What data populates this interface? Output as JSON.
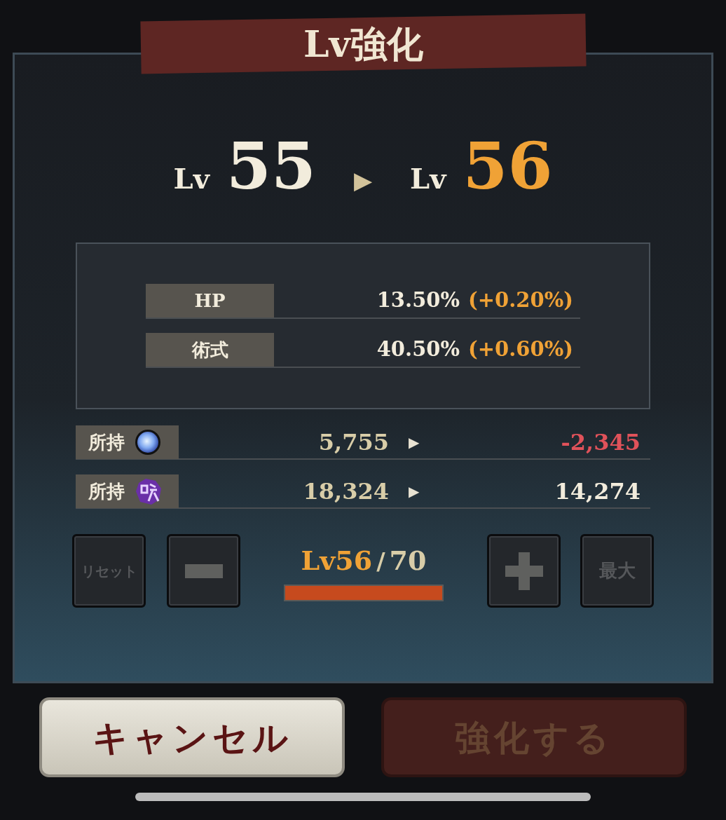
{
  "title": "Lv強化",
  "level_change": {
    "from_prefix": "Lv",
    "from": "55",
    "arrow": "▶",
    "to_prefix": "Lv",
    "to": "56"
  },
  "stats": [
    {
      "label": "HP",
      "value": "13.50%",
      "delta": "(+0.20%)"
    },
    {
      "label": "術式",
      "value": "40.50%",
      "delta": "(+0.60%)"
    }
  ],
  "resources": [
    {
      "label": "所持",
      "kind": "orb",
      "current": "5,755",
      "arrow": "▶",
      "after": "-2,345",
      "insufficient": true
    },
    {
      "label": "所持",
      "kind": "curse",
      "current": "18,324",
      "arrow": "▶",
      "after": "14,274",
      "insufficient": false
    }
  ],
  "controls": {
    "reset": {
      "label": "リセット",
      "disabled": true
    },
    "minus": {
      "disabled": true
    },
    "level_label": "Lv56",
    "separator": "/",
    "max_level": "70",
    "level": 1,
    "plus": {
      "disabled": true
    },
    "max": {
      "label": "最大",
      "disabled": true
    }
  },
  "buttons": [
    {
      "label": "キャンセル",
      "kind": "light",
      "disabled": false
    },
    {
      "label": "強化する",
      "kind": "red",
      "disabled": true
    }
  ]
}
